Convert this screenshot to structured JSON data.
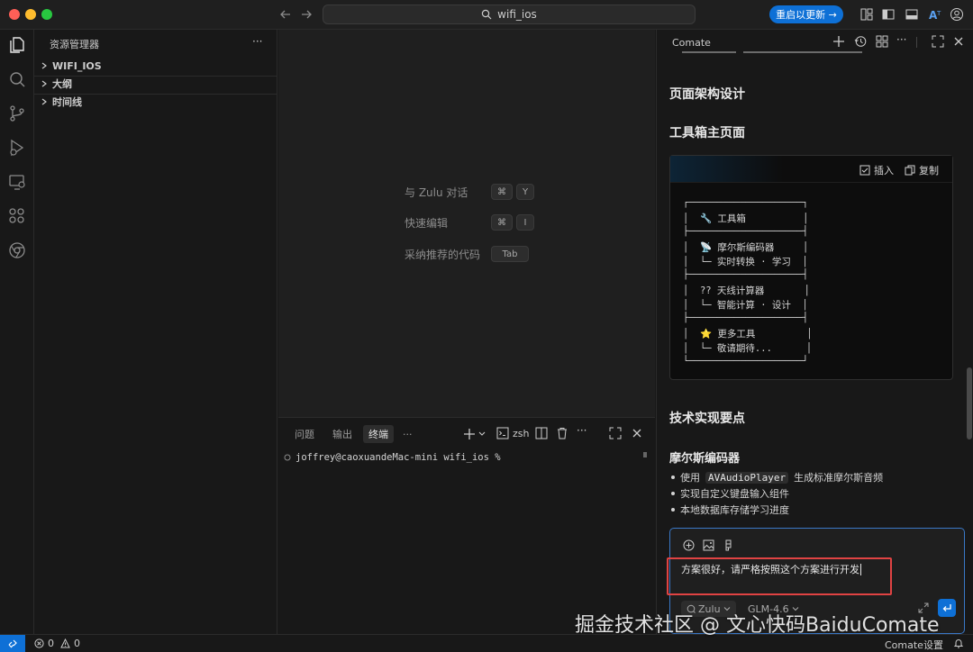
{
  "titlebar": {
    "search_text": "wifi_ios",
    "update_button": "重启以更新 →"
  },
  "explorer": {
    "title": "资源管理器",
    "more": "···",
    "items": [
      {
        "label": "WIFI_IOS"
      },
      {
        "label": "大纲"
      },
      {
        "label": "时间线"
      }
    ]
  },
  "editor": {
    "hints": [
      {
        "label": "与 Zulu 对话",
        "keys": [
          "⌘",
          "Y"
        ]
      },
      {
        "label": "快速编辑",
        "keys": [
          "⌘",
          "I"
        ]
      },
      {
        "label": "采纳推荐的代码",
        "keys": [
          "Tab"
        ]
      }
    ]
  },
  "panel": {
    "tabs": [
      "问题",
      "输出",
      "终端"
    ],
    "more": "···",
    "shell": "zsh",
    "prompt": "joffrey@caoxuandeMac-mini wifi_ios %"
  },
  "chat": {
    "title": "Comate",
    "heading_page_arch": "页面架构设计",
    "heading_toolbox": "工具箱主页面",
    "insert_label": "插入",
    "copy_label": "复制",
    "code_lines": [
      "┌────────────────────┐",
      "│  🔧 工具箱          │",
      "├────────────────────┤",
      "│  📡 摩尔斯编码器     │",
      "│  └─ 实时转换 · 学习  │",
      "├────────────────────┤",
      "│  ?? 天线计算器       │",
      "│  └─ 智能计算 · 设计  │",
      "├────────────────────┤",
      "│  ⭐ 更多工具         │",
      "│  └─ 敬请期待...      │",
      "└────────────────────┘"
    ],
    "heading_tech": "技术实现要点",
    "heading_morse": "摩尔斯编码器",
    "bullets": {
      "b1_prefix": "使用",
      "b1_code": "AVAudioPlayer",
      "b1_suffix": "生成标准摩尔斯音频",
      "b2": "实现自定义键盘输入组件",
      "b3": "本地数据库存储学习进度"
    },
    "input_text": "方案很好，请严格按照这个方案进行开发",
    "agent": "Zulu",
    "model": "GLM-4.6"
  },
  "statusbar": {
    "errors": "0",
    "warnings": "0",
    "settings": "Comate设置"
  },
  "watermark": "掘金技术社区 @ 文心快码BaiduComate",
  "colors": {
    "accent": "#0e70d6",
    "highlight": "#e04343"
  }
}
